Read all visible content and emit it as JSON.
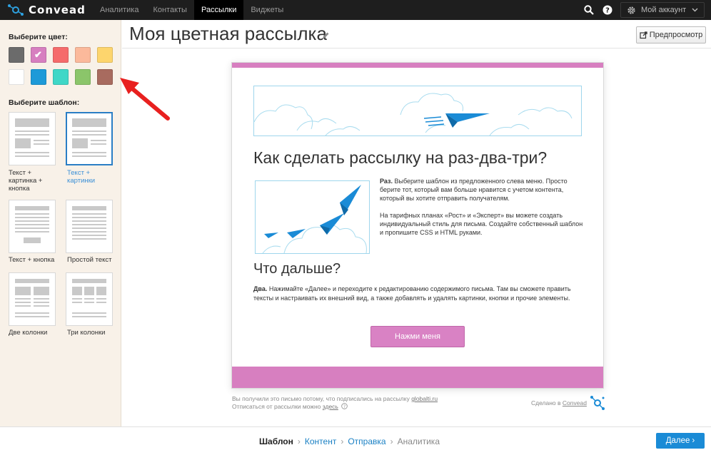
{
  "app": {
    "name": "Convead"
  },
  "nav": {
    "items": [
      {
        "label": "Аналитика",
        "active": false
      },
      {
        "label": "Контакты",
        "active": false
      },
      {
        "label": "Рассылки",
        "active": true
      },
      {
        "label": "Виджеты",
        "active": false
      }
    ],
    "account_label": "Мой аккаунт",
    "icons": [
      "search-icon",
      "help-icon",
      "gear-icon",
      "chevron-down-icon"
    ]
  },
  "sidebar": {
    "color_title": "Выберите цвет:",
    "colors": [
      {
        "hex": "#6b6b6b",
        "selected": false
      },
      {
        "hex": "#d77fc0",
        "selected": true
      },
      {
        "hex": "#f56b6b",
        "selected": false
      },
      {
        "hex": "#fbb99b",
        "selected": false
      },
      {
        "hex": "#fdd56d",
        "selected": false
      },
      {
        "hex": "#ffffff",
        "selected": false
      },
      {
        "hex": "#1d9ad8",
        "selected": false
      },
      {
        "hex": "#3fd7c7",
        "selected": false
      },
      {
        "hex": "#8bc56a",
        "selected": false
      },
      {
        "hex": "#a86b5f",
        "selected": false
      }
    ],
    "template_title": "Выберите шаблон:",
    "templates": [
      {
        "label": "Текст + картинка + кнопка",
        "selected": false
      },
      {
        "label": "Текст + картинки",
        "selected": true
      },
      {
        "label": "Текст + кнопка",
        "selected": false
      },
      {
        "label": "Простой текст",
        "selected": false
      },
      {
        "label": "Две колонки",
        "selected": false
      },
      {
        "label": "Три колонки",
        "selected": false
      }
    ]
  },
  "editor": {
    "title": "Моя цветная рассылка",
    "preview_label": "Предпросмотр"
  },
  "email": {
    "heading": "Как сделать рассылку на раз-два-три?",
    "step1_bold": "Раз.",
    "step1_text": " Выберите шаблон из предложенного слева меню. Просто берите тот, который вам больше нравится с учетом контента, который вы хотите отправить получателям.",
    "step1_text2": "На тарифных планах «Рост» и «Эксперт» вы можете создать индивидуальный стиль для письма. Создайте собственный шаблон и пропишите CSS и HTML руками.",
    "subheading": "Что дальше?",
    "step2_bold": "Два.",
    "step2_text": " Нажимайте «Далее» и переходите к редактированию содержимого письма. Там вы сможете править тексты и настраивать их внешний вид, а также добавлять и удалять картинки, кнопки и прочие элементы.",
    "cta_label": "Нажми меня"
  },
  "footer": {
    "line1_prefix": "Вы получили это письмо потому, что подписались на рассылку ",
    "line1_link": "globalti.ru",
    "line2_prefix": "Отписаться от рассылки можно ",
    "line2_link": "здесь",
    "made_prefix": "Сделано в ",
    "made_link": "Convead"
  },
  "wizard": {
    "steps": [
      {
        "label": "Шаблон",
        "state": "current"
      },
      {
        "label": "Контент",
        "state": "link"
      },
      {
        "label": "Отправка",
        "state": "link"
      },
      {
        "label": "Аналитика",
        "state": "future"
      }
    ],
    "next_label": "Далее"
  }
}
